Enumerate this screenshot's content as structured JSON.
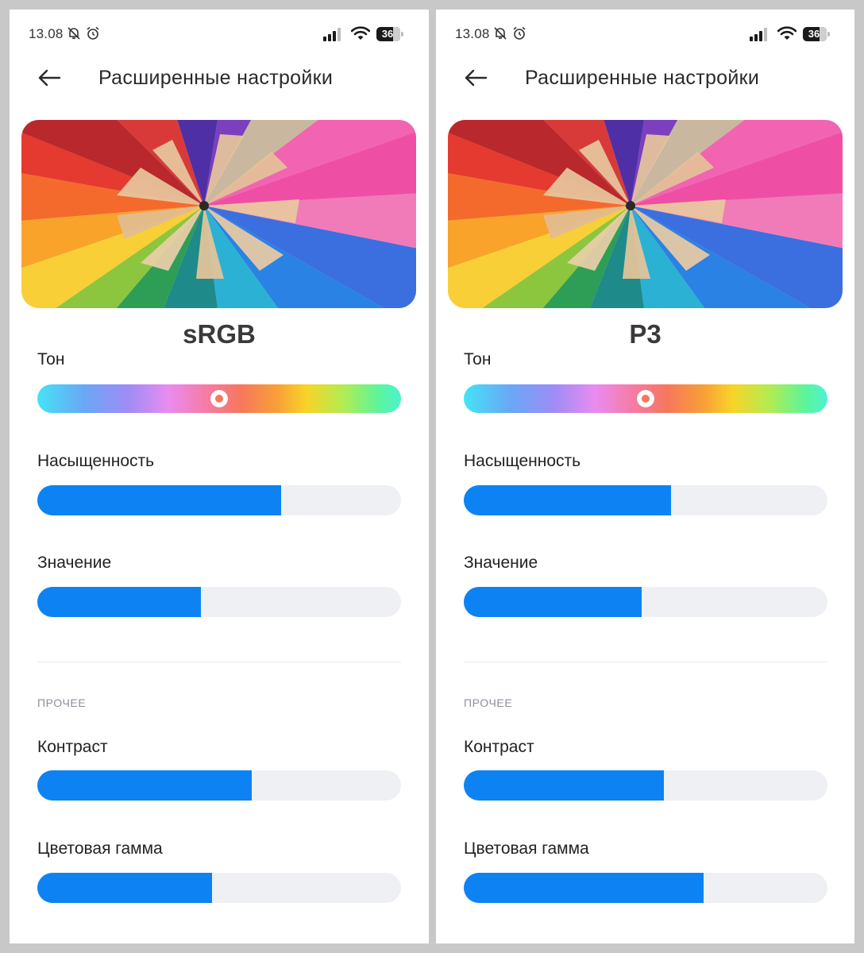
{
  "panels": [
    {
      "status": {
        "time": "13.08",
        "battery": "36"
      },
      "header": {
        "title": "Расширенные настройки"
      },
      "mode": "sRGB",
      "settings": {
        "hue": {
          "label": "Тон",
          "value": 0.5
        },
        "saturation": {
          "label": "Насыщенность",
          "value": 0.67
        },
        "brightness": {
          "label": "Значение",
          "value": 0.45
        }
      },
      "other": {
        "section_title": "ПРОЧЕЕ",
        "contrast": {
          "label": "Контраст",
          "value": 0.59
        },
        "gamut": {
          "label": "Цветовая гамма",
          "value": 0.48
        }
      }
    },
    {
      "status": {
        "time": "13.08",
        "battery": "36"
      },
      "header": {
        "title": "Расширенные настройки"
      },
      "mode": "P3",
      "settings": {
        "hue": {
          "label": "Тон",
          "value": 0.5
        },
        "saturation": {
          "label": "Насыщенность",
          "value": 0.57
        },
        "brightness": {
          "label": "Значение",
          "value": 0.49
        }
      },
      "other": {
        "section_title": "ПРОЧЕЕ",
        "contrast": {
          "label": "Контраст",
          "value": 0.55
        },
        "gamut": {
          "label": "Цветовая гамма",
          "value": 0.66
        }
      }
    }
  ],
  "colors": {
    "accent": "#0d83f3",
    "track": "#eef0f4"
  },
  "icons": [
    "back-arrow-icon",
    "bell-off-icon",
    "alarm-clock-icon",
    "signal-icon",
    "wifi-icon",
    "battery-icon"
  ]
}
